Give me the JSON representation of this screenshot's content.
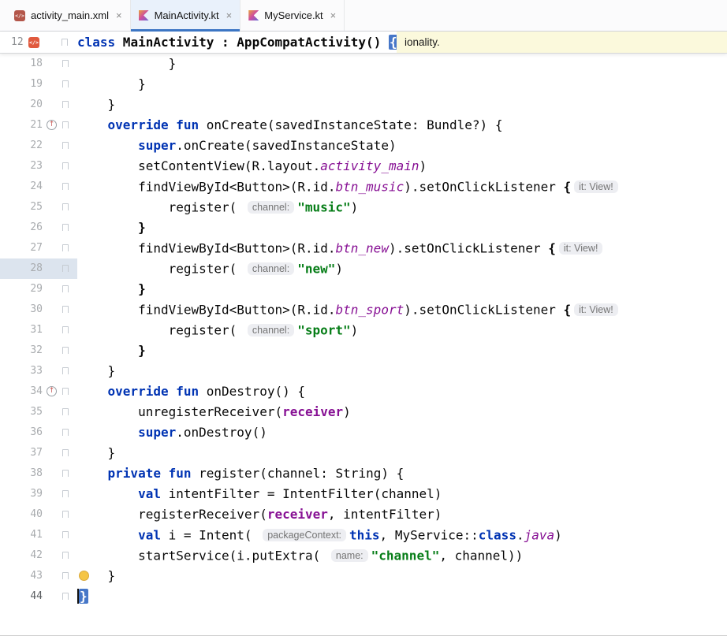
{
  "tabs": [
    {
      "label": "activity_main.xml",
      "active": false,
      "icon": "xml-file-icon"
    },
    {
      "label": "MainActivity.kt",
      "active": true,
      "icon": "kotlin-file-icon"
    },
    {
      "label": "MyService.kt",
      "active": false,
      "icon": "kotlin-file-icon"
    }
  ],
  "icons": {
    "xml_file": "</>",
    "class_marker": "</>",
    "close": "×",
    "override_marker": "↑"
  },
  "colors": {
    "keyword": "#0033b3",
    "string": "#067d17",
    "field": "#871094",
    "active_tab_underline": "#3d76c4",
    "brace_match_bg": "#4677c8",
    "tooltip_bg": "#fbf9dc",
    "bulb": "#f5c546"
  },
  "sticky": {
    "line_number": "12",
    "tooltip": "ionality.",
    "segments": [
      [
        "k",
        "class"
      ],
      [
        "b",
        " MainActivity : AppCompatActivity() "
      ],
      [
        "hl",
        "{"
      ]
    ]
  },
  "editor": {
    "lines": [
      {
        "n": 18,
        "seg": [
          [
            "p",
            "            }"
          ]
        ]
      },
      {
        "n": 19,
        "seg": [
          [
            "p",
            "        }"
          ]
        ]
      },
      {
        "n": 20,
        "seg": [
          [
            "p",
            "    }"
          ]
        ]
      },
      {
        "n": 21,
        "g": "override",
        "seg": [
          [
            "p",
            "    "
          ],
          [
            "k",
            "override"
          ],
          [
            "p",
            " "
          ],
          [
            "k",
            "fun"
          ],
          [
            "p",
            " onCreate(savedInstanceState: Bundle?) {"
          ]
        ]
      },
      {
        "n": 22,
        "seg": [
          [
            "p",
            "        "
          ],
          [
            "k",
            "super"
          ],
          [
            "p",
            ".onCreate(savedInstanceState)"
          ]
        ]
      },
      {
        "n": 23,
        "seg": [
          [
            "p",
            "        setContentView(R.layout."
          ],
          [
            "f",
            "activity_main"
          ],
          [
            "p",
            ")"
          ]
        ]
      },
      {
        "n": 24,
        "seg": [
          [
            "p",
            "        findViewById<Button>(R.id."
          ],
          [
            "f",
            "btn_music"
          ],
          [
            "p",
            ").setOnClickListener "
          ],
          [
            "b",
            "{"
          ],
          [
            "h",
            "it: View!"
          ]
        ]
      },
      {
        "n": 25,
        "seg": [
          [
            "p",
            "            register( "
          ],
          [
            "h",
            "channel:"
          ],
          [
            "s",
            "\"music\""
          ],
          [
            "p",
            ")"
          ]
        ]
      },
      {
        "n": 26,
        "seg": [
          [
            "p",
            "        "
          ],
          [
            "b",
            "}"
          ]
        ]
      },
      {
        "n": 27,
        "seg": [
          [
            "p",
            "        findViewById<Button>(R.id."
          ],
          [
            "f",
            "btn_new"
          ],
          [
            "p",
            ").setOnClickListener "
          ],
          [
            "b",
            "{"
          ],
          [
            "h",
            "it: View!"
          ]
        ]
      },
      {
        "n": 28,
        "hl": true,
        "seg": [
          [
            "p",
            "            register( "
          ],
          [
            "h",
            "channel:"
          ],
          [
            "s",
            "\"new\""
          ],
          [
            "p",
            ")"
          ]
        ]
      },
      {
        "n": 29,
        "seg": [
          [
            "p",
            "        "
          ],
          [
            "b",
            "}"
          ]
        ]
      },
      {
        "n": 30,
        "seg": [
          [
            "p",
            "        findViewById<Button>(R.id."
          ],
          [
            "f",
            "btn_sport"
          ],
          [
            "p",
            ").setOnClickListener "
          ],
          [
            "b",
            "{"
          ],
          [
            "h",
            "it: View!"
          ]
        ]
      },
      {
        "n": 31,
        "seg": [
          [
            "p",
            "            register( "
          ],
          [
            "h",
            "channel:"
          ],
          [
            "s",
            "\"sport\""
          ],
          [
            "p",
            ")"
          ]
        ]
      },
      {
        "n": 32,
        "seg": [
          [
            "p",
            "        "
          ],
          [
            "b",
            "}"
          ]
        ]
      },
      {
        "n": 33,
        "seg": [
          [
            "p",
            "    }"
          ]
        ]
      },
      {
        "n": 34,
        "g": "override",
        "seg": [
          [
            "p",
            "    "
          ],
          [
            "k",
            "override"
          ],
          [
            "p",
            " "
          ],
          [
            "k",
            "fun"
          ],
          [
            "p",
            " onDestroy() {"
          ]
        ]
      },
      {
        "n": 35,
        "seg": [
          [
            "p",
            "        unregisterReceiver("
          ],
          [
            "r",
            "receiver"
          ],
          [
            "p",
            ")"
          ]
        ]
      },
      {
        "n": 36,
        "seg": [
          [
            "p",
            "        "
          ],
          [
            "k",
            "super"
          ],
          [
            "p",
            ".onDestroy()"
          ]
        ]
      },
      {
        "n": 37,
        "seg": [
          [
            "p",
            "    }"
          ]
        ]
      },
      {
        "n": 38,
        "seg": [
          [
            "p",
            "    "
          ],
          [
            "k",
            "private"
          ],
          [
            "p",
            " "
          ],
          [
            "k",
            "fun"
          ],
          [
            "p",
            " register(channel: String) {"
          ]
        ]
      },
      {
        "n": 39,
        "seg": [
          [
            "p",
            "        "
          ],
          [
            "k",
            "val"
          ],
          [
            "p",
            " intentFilter = IntentFilter(channel)"
          ]
        ]
      },
      {
        "n": 40,
        "seg": [
          [
            "p",
            "        registerReceiver("
          ],
          [
            "r",
            "receiver"
          ],
          [
            "p",
            ", intentFilter)"
          ]
        ]
      },
      {
        "n": 41,
        "seg": [
          [
            "p",
            "        "
          ],
          [
            "k",
            "val"
          ],
          [
            "p",
            " i = Intent( "
          ],
          [
            "h",
            "packageContext:"
          ],
          [
            "k",
            "this"
          ],
          [
            "p",
            ", MyService::"
          ],
          [
            "k",
            "class"
          ],
          [
            "p",
            "."
          ],
          [
            "f",
            "java"
          ],
          [
            "p",
            ")"
          ]
        ]
      },
      {
        "n": 42,
        "seg": [
          [
            "p",
            "        startService(i.putExtra( "
          ],
          [
            "h",
            "name:"
          ],
          [
            "s",
            "\"channel\""
          ],
          [
            "p",
            ", channel))"
          ]
        ]
      },
      {
        "n": 43,
        "g": "bulb",
        "seg": [
          [
            "p",
            "    }"
          ]
        ]
      },
      {
        "n": 44,
        "seg": [
          [
            "caret",
            ""
          ],
          [
            "hl",
            "}"
          ]
        ]
      }
    ]
  }
}
